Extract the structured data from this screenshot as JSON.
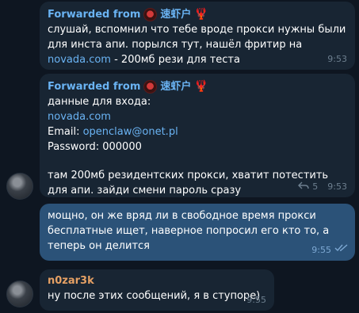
{
  "messages": [
    {
      "forward_prefix": "Forwarded from",
      "channel_name": "速虾户",
      "channel_emoji": "🦞",
      "text_before_link": "слушай, вспомнил что тебе вроде прокси нужны были для инста апи. порылся тут, нашёл фритир на ",
      "link": "novada.com",
      "text_after_link": " - 200мб рези для теста",
      "time": "9:53"
    },
    {
      "forward_prefix": "Forwarded from",
      "channel_name": "速虾户",
      "channel_emoji": "🦞",
      "line1": "данные для входа:",
      "link": "novada.com",
      "email_label": "Email: ",
      "email": "openclaw@onet.pl",
      "password_line": "Password: 000000",
      "body": "там 200мб резидентских прокси, хватит потестить для апи. зайди смени пароль сразу",
      "replies": "5",
      "time": "9:53"
    },
    {
      "text": "мощно, он же вряд ли в свободное время прокси бесплатные ищет, наверное попросил его кто то, а теперь он делится",
      "time": "9:55"
    },
    {
      "sender": "n0zar3k",
      "text": "ну после этих сообщений, я в ступоре)",
      "time": "9:55"
    }
  ],
  "colors": {
    "background": "#0e1621",
    "incoming_bubble": "#182533",
    "outgoing_bubble": "#2b5278",
    "link": "#6ab3f3",
    "sender_name": "#e5a064"
  },
  "icons": [
    "channel-avatar-icon",
    "lobster-emoji-icon",
    "reply-arrow-icon",
    "double-check-icon"
  ]
}
